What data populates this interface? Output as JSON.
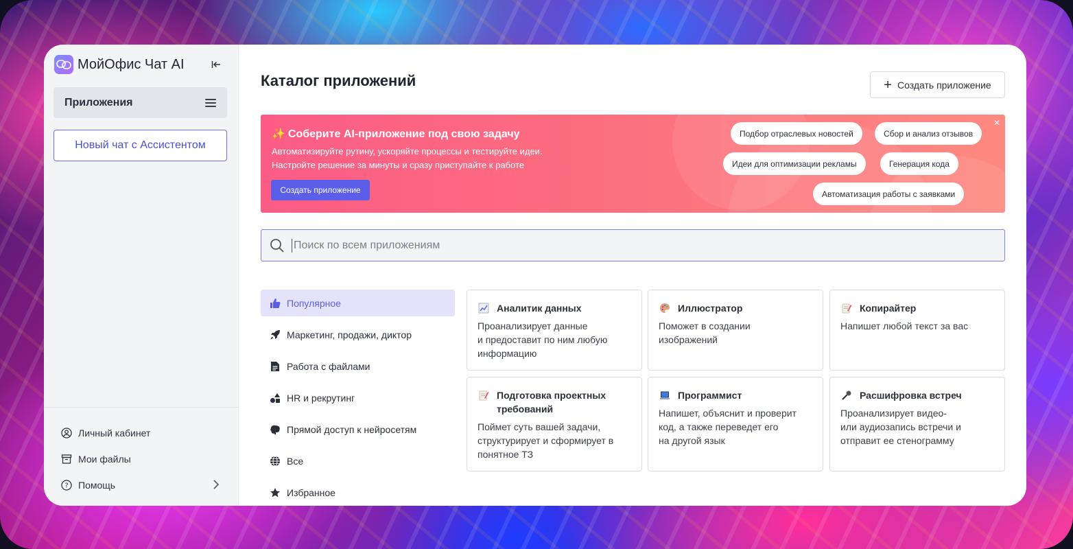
{
  "app": {
    "title": "МойОфис Чат AI"
  },
  "sidebar": {
    "apps_label": "Приложения",
    "new_chat": "Новый чат с Ассистентом",
    "bottom": [
      {
        "label": "Личный кабинет",
        "icon": "user-circle-icon"
      },
      {
        "label": "Мои файлы",
        "icon": "archive-icon"
      },
      {
        "label": "Помощь",
        "icon": "help-circle-icon"
      }
    ]
  },
  "main": {
    "title": "Каталог приложений",
    "create_button": "Создать приложение",
    "banner": {
      "title": "Соберите AI-приложение под свою задачу",
      "line1": "Автоматизируйте рутину, ускоряйте процессы и тестируйте идеи.",
      "line2": "Настройте решение за минуты и сразу приступайте к работе",
      "button": "Создать приложение",
      "chips": [
        "Подбор отраслевых новостей",
        "Сбор и анализ отзывов",
        "Идеи для оптимизации рекламы",
        "Генерация кода",
        "Автоматизация работы с заявками"
      ]
    },
    "search": {
      "placeholder": "Поиск по всем приложениям"
    },
    "categories": [
      {
        "label": "Популярное",
        "icon": "thumbs-up-icon"
      },
      {
        "label": "Маркетинг, продажи, диктор",
        "icon": "rocket-icon"
      },
      {
        "label": "Работа с файлами",
        "icon": "file-icon"
      },
      {
        "label": "HR и рекрутинг",
        "icon": "shapes-icon"
      },
      {
        "label": "Прямой доступ к нейросетям",
        "icon": "brain-icon"
      },
      {
        "label": "Все",
        "icon": "globe-icon"
      },
      {
        "label": "Избранное",
        "icon": "star-icon"
      }
    ],
    "cards": [
      {
        "title": "Аналитик данных",
        "desc1": "Проанализирует данные",
        "desc2": "и предоставит по ним любую",
        "desc3": "информацию",
        "icon": "chart-icon"
      },
      {
        "title": "Иллюстратор",
        "desc1": "Поможет в создании",
        "desc2": "изображений",
        "desc3": "",
        "icon": "palette-icon"
      },
      {
        "title": "Копирайтер",
        "desc1": "Напишет любой текст за вас",
        "desc2": "",
        "desc3": "",
        "icon": "memo-icon"
      },
      {
        "title": "Подготовка проектных",
        "title2": "требований",
        "desc1": "Поймет суть вашей задачи,",
        "desc2": "структурирует и сформирует в",
        "desc3": "понятное ТЗ",
        "icon": "memo-icon"
      },
      {
        "title": "Программист",
        "desc1": "Напишет, объяснит и проверит",
        "desc2": "код, а также переведет его",
        "desc3": "на другой язык",
        "icon": "laptop-icon"
      },
      {
        "title": "Расшифровка встреч",
        "desc1": "Проанализирует видео-",
        "desc2": "или аудиозапись встречи и",
        "desc3": "отправит ее стенограмму",
        "icon": "microphone-icon"
      }
    ]
  }
}
